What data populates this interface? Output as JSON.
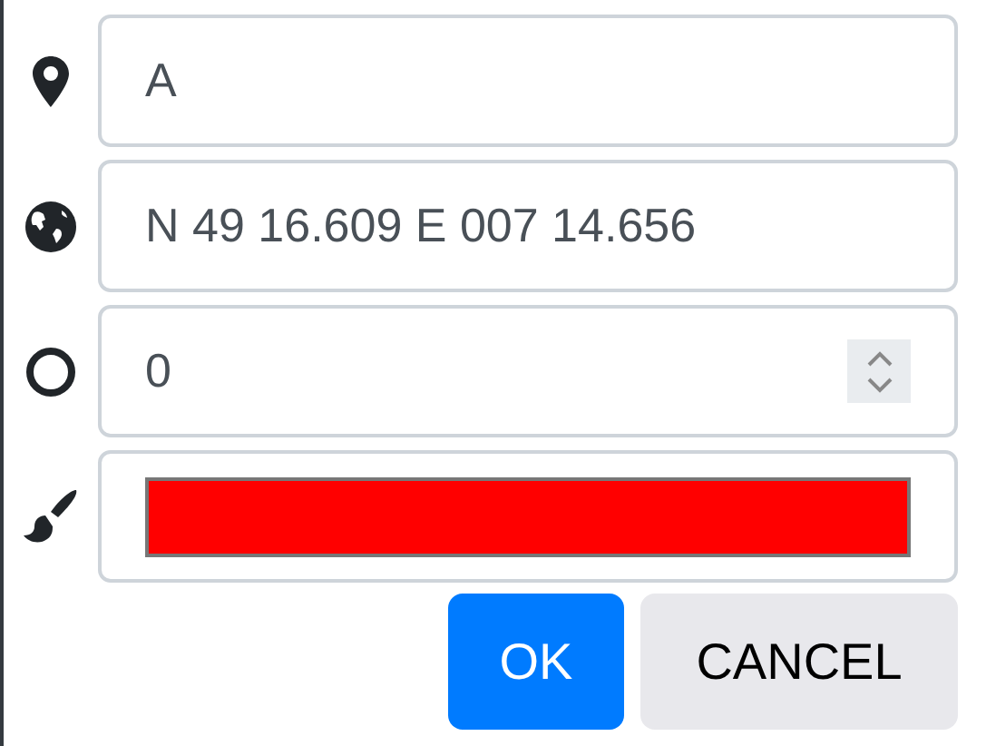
{
  "fields": [
    {
      "kind": "name",
      "value": "A"
    },
    {
      "kind": "coordinates",
      "value": "N 49 16.609 E 007 14.656"
    },
    {
      "kind": "number",
      "value": "0"
    },
    {
      "kind": "color",
      "color": "#ff0000"
    }
  ],
  "buttons": [
    {
      "label": "OK",
      "primary": true
    },
    {
      "label": "CANCEL",
      "primary": false
    }
  ]
}
